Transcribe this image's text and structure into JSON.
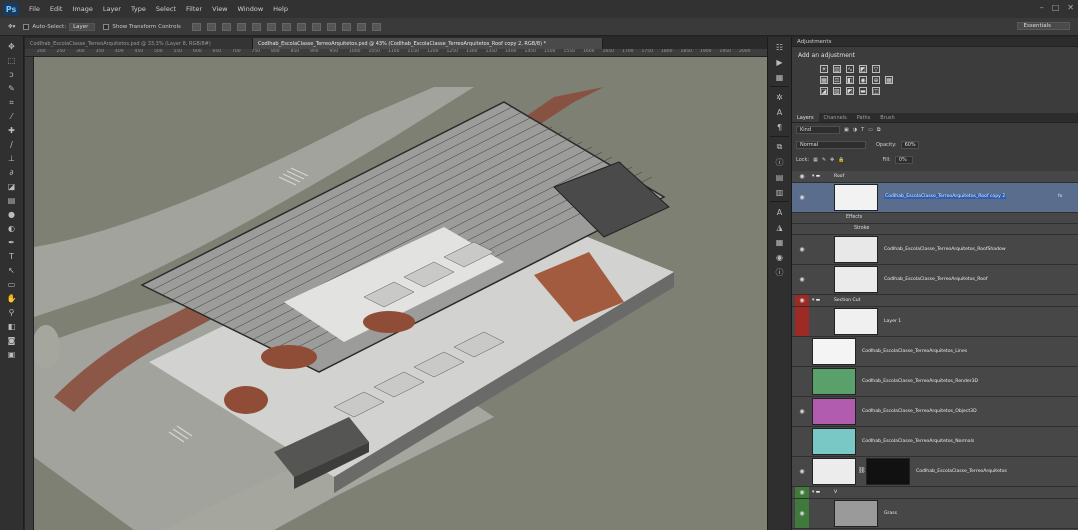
{
  "app": {
    "logo": "Ps"
  },
  "menu": [
    "File",
    "Edit",
    "Image",
    "Layer",
    "Type",
    "Select",
    "Filter",
    "View",
    "Window",
    "Help"
  ],
  "window_controls": [
    "–",
    "□",
    "✕"
  ],
  "options": {
    "auto_select_label": "Auto-Select:",
    "auto_select_value": "Layer",
    "show_transform_label": "Show Transform Controls",
    "workspace": "Essentials"
  },
  "tabs": [
    "CodIhab_EscolaClasse_TerreoArquitetos.psd @ 33,3% (Layer 8, RGB/8#)",
    "CodIhab_EscolaClasse_TerreoArquitetos.psd @ 43% (CodIhab_EscolaClasse_TerreoArquitetos_Roof copy 2, RGB/8) *"
  ],
  "ruler_ticks": [
    "200",
    "250",
    "300",
    "350",
    "400",
    "450",
    "500",
    "550",
    "600",
    "650",
    "700",
    "750",
    "800",
    "850",
    "900",
    "950",
    "1000",
    "1050",
    "1100",
    "1150",
    "1200",
    "1250",
    "1300",
    "1350",
    "1400",
    "1450",
    "1500",
    "1550",
    "1600",
    "1650",
    "1700",
    "1750",
    "1800",
    "1850",
    "1900",
    "1950",
    "2000"
  ],
  "panels": {
    "adjustments_tab": "Adjustments",
    "adjustments_title": "Add an adjustment",
    "layer_tabs": [
      "Layers",
      "Channels",
      "Paths",
      "Brush"
    ],
    "filter_kind": "Kind",
    "blend_mode": "Normal",
    "opacity_label": "Opacity:",
    "opacity_value": "60%",
    "lock_label": "Lock:",
    "fill_label": "Fill:",
    "fill_value": "0%"
  },
  "layers": [
    {
      "name": "Roof"
    },
    {
      "name": "CodIhab_EscolaClasse_TerreoArquitetos_Roof copy 2"
    },
    {
      "name": "Effects"
    },
    {
      "name": "Stroke"
    },
    {
      "name": "CodIhab_EscolaClasse_TerreoArquitetos_RoofShadow"
    },
    {
      "name": "CodIhab_EscolaClasse_TerreoArquitetos_Roof"
    },
    {
      "name": "Section Cut"
    },
    {
      "name": "Layer 1"
    },
    {
      "name": "CodIhab_EscolaClasse_TerreoArquitetos_Lines"
    },
    {
      "name": "CodIhab_EscolaClasse_TerreoArquitetos_Render3D"
    },
    {
      "name": "CodIhab_EscolaClasse_TerreoArquitetos_Object3D"
    },
    {
      "name": "CodIhab_EscolaClasse_TerreoArquitetos_Normals"
    },
    {
      "name": "CodIhab_EscolaClasse_TerreoArquitetos"
    },
    {
      "name": "V"
    },
    {
      "name": "Grass"
    }
  ],
  "colors": {
    "accent_selected": "#5a6d8c",
    "red_label": "#9d2a25",
    "green_label": "#3f7a3c",
    "canvas_bg": "#7f8073"
  }
}
